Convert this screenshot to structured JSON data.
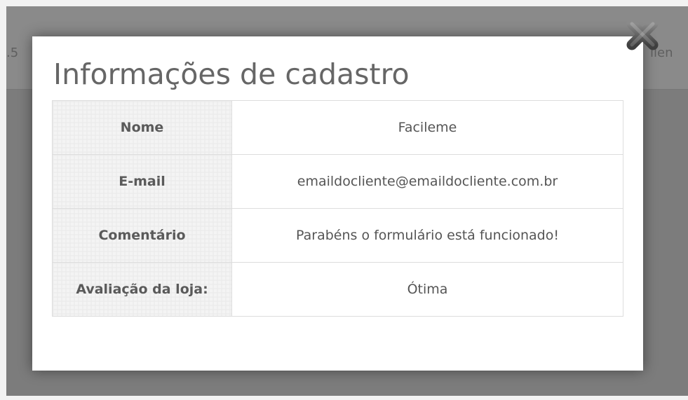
{
  "background": {
    "left_fragment": ".5",
    "right_fragment": "ilen"
  },
  "modal": {
    "title": "Informações de cadastro",
    "rows": [
      {
        "label": "Nome",
        "value": "Facileme"
      },
      {
        "label": "E-mail",
        "value": "emaildocliente@emaildocliente.com.br"
      },
      {
        "label": "Comentário",
        "value": "Parabéns o formulário está funcionado!"
      },
      {
        "label": "Avaliação da loja:",
        "value": "Ótima"
      }
    ]
  },
  "icons": {
    "close": "close-icon"
  },
  "colors": {
    "overlay": "#7c7c7c",
    "modal_bg": "#ffffff",
    "title": "#666666",
    "border": "#dddddd",
    "label_bg": "#f4f4f4",
    "close_icon": "#5a5a5a"
  }
}
